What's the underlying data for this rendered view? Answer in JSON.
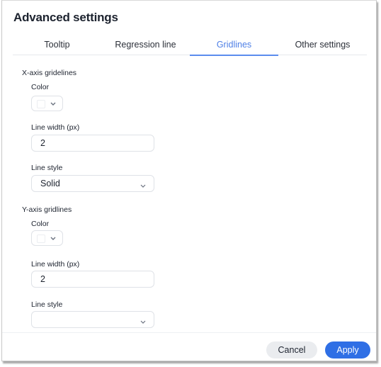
{
  "dialog": {
    "title": "Advanced settings",
    "tabs": [
      {
        "label": "Tooltip",
        "active": false
      },
      {
        "label": "Regression line",
        "active": false
      },
      {
        "label": "Gridlines",
        "active": true
      },
      {
        "label": "Other settings",
        "active": false
      }
    ],
    "x_axis": {
      "section_label": "X-axis gridelines",
      "color_label": "Color",
      "color_value": "#ffffff",
      "line_width_label": "Line width (px)",
      "line_width_value": "2",
      "line_style_label": "Line style",
      "line_style_value": "Solid"
    },
    "y_axis": {
      "section_label": "Y-axis gridlines",
      "color_label": "Color",
      "color_value": "#ffffff",
      "line_width_label": "Line width (px)",
      "line_width_value": "2",
      "line_style_label": "Line style",
      "line_style_value": ""
    },
    "footer": {
      "cancel_label": "Cancel",
      "apply_label": "Apply"
    },
    "colors": {
      "accent": "#2f6fe5",
      "active_tab": "#4e7fe6"
    }
  }
}
